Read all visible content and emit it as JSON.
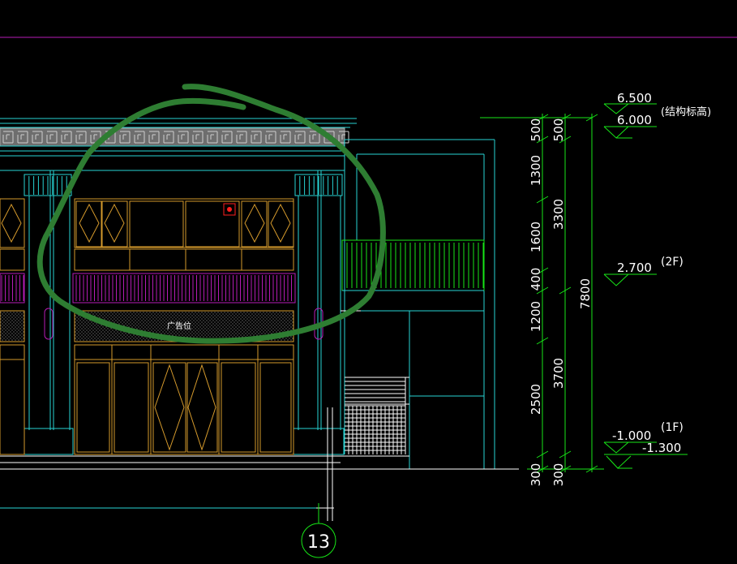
{
  "drawing": {
    "background": "#000000",
    "colors": {
      "cyan": "#27d3d3",
      "orange": "#d59a2c",
      "green": "#17e617",
      "magenta": "#b61cb6",
      "white": "#ffffff",
      "grey": "#a8a8a8",
      "red": "#ff1e1e",
      "annotation": "#2e7d32"
    },
    "elevations": {
      "roof_top": "6.500",
      "roof_structure": "6.000",
      "roof_structure_note": "(结构标高)",
      "second_floor": "2.700",
      "second_floor_tag": "(2F)",
      "first_floor": "-1.000",
      "first_floor_tag": "(1F)",
      "ground": "-1.300"
    },
    "dimensions_inner": [
      "500",
      "1300",
      "1600",
      "400",
      "1200",
      "2500",
      "300"
    ],
    "dimensions_middle": [
      "500",
      "3300",
      "3700",
      "300"
    ],
    "dimension_total": "7800",
    "sign_text": "广告位",
    "grid_axis": "13"
  }
}
